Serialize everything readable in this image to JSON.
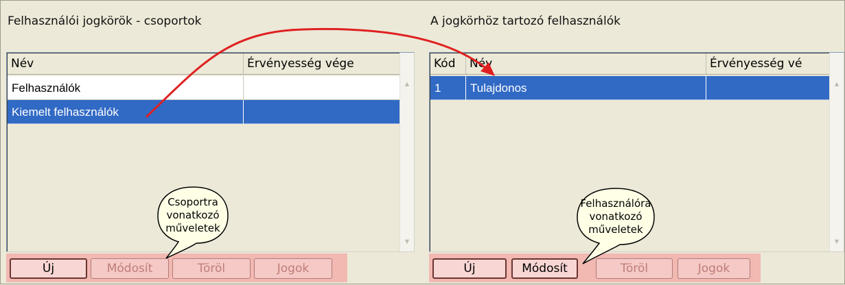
{
  "left_panel": {
    "title": "Felhasználói jogkörök - csoportok",
    "columns": [
      "Név",
      "Érvényesség vége"
    ],
    "rows": [
      {
        "name": "Felhasználók",
        "validity": ""
      },
      {
        "name": "Kiemelt felhasználók",
        "validity": ""
      }
    ],
    "selected_row": 1,
    "buttons": {
      "new": "Új",
      "edit": "Módosít",
      "delete": "Töröl",
      "rights": "Jogok"
    },
    "callout": [
      "Csoportra",
      "vonatkozó",
      "műveletek"
    ]
  },
  "right_panel": {
    "title": "A jogkörhöz tartozó felhasználók",
    "columns": [
      "Kód",
      "Név",
      "Érvényesség vé"
    ],
    "rows": [
      {
        "code": "1",
        "name": "Tulajdonos",
        "validity": ""
      }
    ],
    "selected_row": 0,
    "buttons": {
      "new": "Új",
      "edit": "Módosít",
      "delete": "Töröl",
      "rights": "Jogok"
    },
    "callout": [
      "Felhasználóra",
      "vonatkozó",
      "műveletek"
    ]
  },
  "colors": {
    "selection": "#316ac5",
    "button_bar": "#f2b8b2",
    "arrow": "#e02020",
    "callout_fill": "#ffffe6"
  }
}
